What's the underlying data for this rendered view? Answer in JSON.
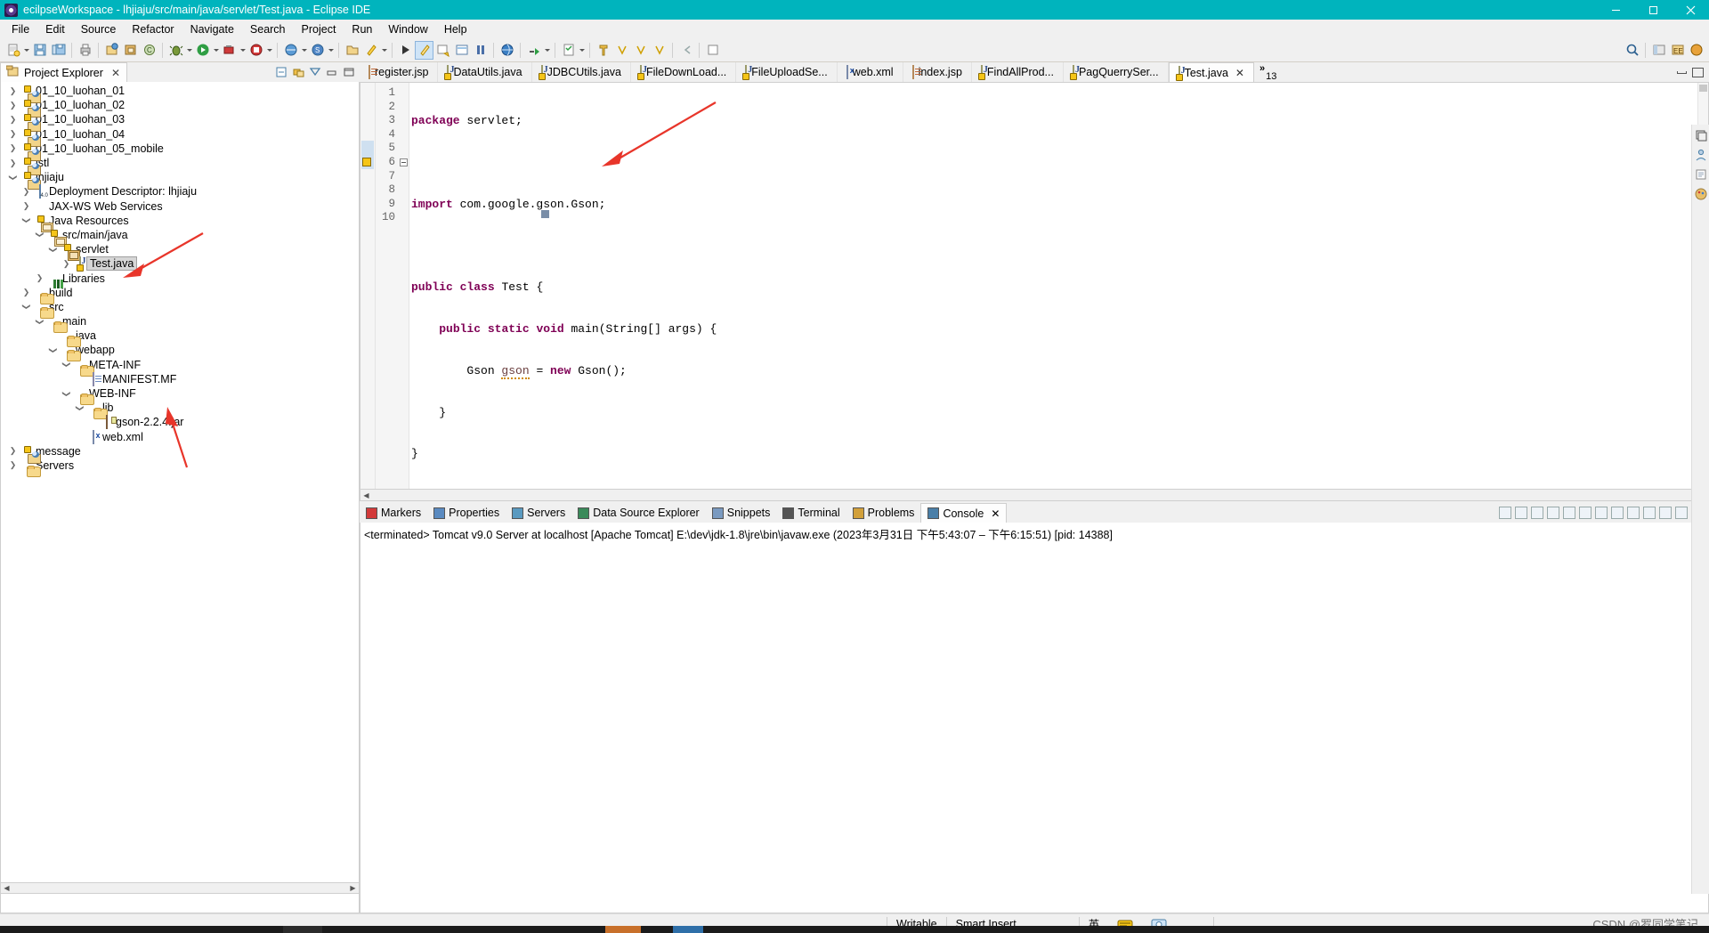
{
  "window": {
    "title": "ecilpseWorkspace - lhjiaju/src/main/java/servlet/Test.java - Eclipse IDE",
    "app_icon": "eclipse-icon",
    "minimize": "minimize-icon",
    "maximize": "maximize-icon",
    "close": "close-icon"
  },
  "menubar": {
    "items": [
      {
        "label": "File"
      },
      {
        "label": "Edit"
      },
      {
        "label": "Source"
      },
      {
        "label": "Refactor"
      },
      {
        "label": "Navigate"
      },
      {
        "label": "Search"
      },
      {
        "label": "Project"
      },
      {
        "label": "Run"
      },
      {
        "label": "Window"
      },
      {
        "label": "Help"
      }
    ]
  },
  "project_explorer": {
    "title": "Project Explorer",
    "close_label": "✕",
    "tools": [
      "collapse-all-icon",
      "link-with-editor-icon",
      "view-menu-icon",
      "minimize-icon",
      "maximize-icon"
    ],
    "tree": [
      {
        "label": "01_10_luohan_01",
        "depth": 0,
        "arrow": "collapsed",
        "icon": "java-project-icon"
      },
      {
        "label": "01_10_luohan_02",
        "depth": 0,
        "arrow": "collapsed",
        "icon": "java-project-icon"
      },
      {
        "label": "01_10_luohan_03",
        "depth": 0,
        "arrow": "collapsed",
        "icon": "java-project-icon"
      },
      {
        "label": "01_10_luohan_04",
        "depth": 0,
        "arrow": "collapsed",
        "icon": "java-project-icon"
      },
      {
        "label": "01_10_luohan_05_mobile",
        "depth": 0,
        "arrow": "collapsed",
        "icon": "java-project-icon"
      },
      {
        "label": "jstl",
        "depth": 0,
        "arrow": "collapsed",
        "icon": "java-project-icon"
      },
      {
        "label": "lhjiaju",
        "depth": 0,
        "arrow": "expanded",
        "icon": "java-project-icon"
      },
      {
        "label": "Deployment Descriptor: lhjiaju",
        "depth": 1,
        "arrow": "collapsed",
        "icon": "deployment-descriptor-icon"
      },
      {
        "label": "JAX-WS Web Services",
        "depth": 1,
        "arrow": "collapsed",
        "icon": "web-services-icon"
      },
      {
        "label": "Java Resources",
        "depth": 1,
        "arrow": "expanded",
        "icon": "java-resources-icon"
      },
      {
        "label": "src/main/java",
        "depth": 2,
        "arrow": "expanded",
        "icon": "source-folder-icon"
      },
      {
        "label": "servlet",
        "depth": 3,
        "arrow": "expanded",
        "icon": "package-icon"
      },
      {
        "label": "Test.java",
        "depth": 4,
        "arrow": "collapsed",
        "icon": "java-file-icon",
        "selected": true
      },
      {
        "label": "Libraries",
        "depth": 2,
        "arrow": "collapsed",
        "icon": "libraries-icon"
      },
      {
        "label": "build",
        "depth": 1,
        "arrow": "collapsed",
        "icon": "folder-icon"
      },
      {
        "label": "src",
        "depth": 1,
        "arrow": "expanded",
        "icon": "folder-icon"
      },
      {
        "label": "main",
        "depth": 2,
        "arrow": "expanded",
        "icon": "folder-icon"
      },
      {
        "label": "java",
        "depth": 3,
        "arrow": "none",
        "icon": "folder-icon"
      },
      {
        "label": "webapp",
        "depth": 3,
        "arrow": "expanded",
        "icon": "folder-icon"
      },
      {
        "label": "META-INF",
        "depth": 4,
        "arrow": "expanded",
        "icon": "folder-icon"
      },
      {
        "label": "MANIFEST.MF",
        "depth": 5,
        "arrow": "none",
        "icon": "text-file-icon"
      },
      {
        "label": "WEB-INF",
        "depth": 4,
        "arrow": "expanded",
        "icon": "folder-icon"
      },
      {
        "label": "lib",
        "depth": 5,
        "arrow": "expanded",
        "icon": "folder-icon"
      },
      {
        "label": "gson-2.2.4.jar",
        "depth": 6,
        "arrow": "none",
        "icon": "jar-file-icon"
      },
      {
        "label": "web.xml",
        "depth": 5,
        "arrow": "none",
        "icon": "xml-file-icon"
      },
      {
        "label": "message",
        "depth": 0,
        "arrow": "collapsed",
        "icon": "java-project-icon"
      },
      {
        "label": "Servers",
        "depth": 0,
        "arrow": "collapsed",
        "icon": "folder-icon"
      }
    ]
  },
  "editor": {
    "tabs": [
      {
        "label": "register.jsp",
        "icon": "jsp-file-icon",
        "active": false
      },
      {
        "label": "DataUtils.java",
        "icon": "java-file-icon",
        "active": false
      },
      {
        "label": "JDBCUtils.java",
        "icon": "java-file-icon",
        "active": false
      },
      {
        "label": "FileDownLoad...",
        "icon": "java-file-icon",
        "active": false
      },
      {
        "label": "FileUploadSe...",
        "icon": "java-file-icon",
        "active": false
      },
      {
        "label": "web.xml",
        "icon": "xml-file-icon",
        "active": false
      },
      {
        "label": "index.jsp",
        "icon": "jsp-file-icon",
        "active": false
      },
      {
        "label": "FindAllProd...",
        "icon": "java-file-icon",
        "active": false
      },
      {
        "label": "PagQuerrySer...",
        "icon": "java-file-icon",
        "active": false
      },
      {
        "label": "Test.java",
        "icon": "java-file-icon",
        "active": true,
        "close_label": "✕"
      }
    ],
    "overflow_chevron": "»",
    "overflow_count": "13",
    "minimize": "minimize-icon",
    "maximize": "maximize-icon",
    "code_lines": [
      {
        "n": "1",
        "text": "package servlet;"
      },
      {
        "n": "2",
        "text": ""
      },
      {
        "n": "3",
        "text": "import com.google.gson.Gson;"
      },
      {
        "n": "4",
        "text": ""
      },
      {
        "n": "5",
        "text": "public class Test {"
      },
      {
        "n": "6",
        "text": "    public static void main(String[] args) {"
      },
      {
        "n": "7",
        "text": "        Gson gson = new Gson();"
      },
      {
        "n": "8",
        "text": "    }"
      },
      {
        "n": "9",
        "text": "}"
      },
      {
        "n": "10",
        "text": ""
      }
    ]
  },
  "bottom_panel": {
    "tabs": [
      {
        "label": "Markers",
        "icon": "markers-icon",
        "active": false
      },
      {
        "label": "Properties",
        "icon": "properties-icon",
        "active": false
      },
      {
        "label": "Servers",
        "icon": "servers-icon",
        "active": false
      },
      {
        "label": "Data Source Explorer",
        "icon": "data-source-explorer-icon",
        "active": false
      },
      {
        "label": "Snippets",
        "icon": "snippets-icon",
        "active": false
      },
      {
        "label": "Terminal",
        "icon": "terminal-icon",
        "active": false
      },
      {
        "label": "Problems",
        "icon": "problems-icon",
        "active": false
      },
      {
        "label": "Console",
        "icon": "console-icon",
        "active": true,
        "close_label": "✕"
      }
    ],
    "console_text": "<terminated> Tomcat v9.0 Server at localhost [Apache Tomcat] E:\\dev\\jdk-1.8\\jre\\bin\\javaw.exe  (2023年3月31日 下午5:43:07 – 下午6:15:51) [pid: 14388]"
  },
  "statusbar": {
    "writable": "Writable",
    "insert_mode": "Smart Insert",
    "ime_lang": "英",
    "watermark": "CSDN @罗同学笔记"
  },
  "colors": {
    "titlebar": "#00b4bd",
    "keyword": "#7f0055",
    "field": "#6a3e3e",
    "annotation_arrow": "#e8352a",
    "selection": "#d6d6d6",
    "caret_line": "#e8f2fe"
  }
}
